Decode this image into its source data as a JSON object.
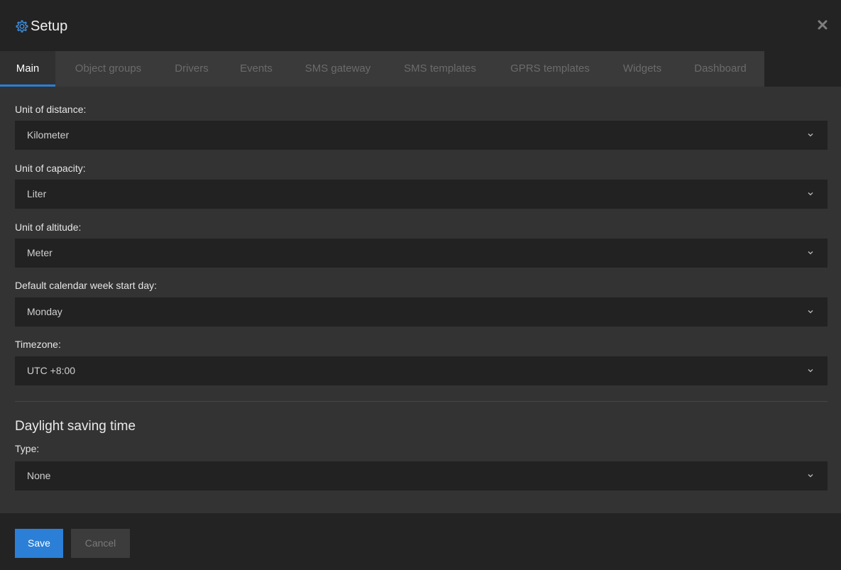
{
  "window": {
    "title": "Setup",
    "close_icon": "close-icon",
    "title_icon": "gear-icon"
  },
  "tabs": [
    {
      "label": "Main",
      "active": true
    },
    {
      "label": "Object groups",
      "active": false
    },
    {
      "label": "Drivers",
      "active": false
    },
    {
      "label": "Events",
      "active": false
    },
    {
      "label": "SMS gateway",
      "active": false
    },
    {
      "label": "SMS templates",
      "active": false
    },
    {
      "label": "GPRS templates",
      "active": false
    },
    {
      "label": "Widgets",
      "active": false
    },
    {
      "label": "Dashboard",
      "active": false
    }
  ],
  "fields": {
    "distance": {
      "label": "Unit of distance:",
      "value": "Kilometer"
    },
    "capacity": {
      "label": "Unit of capacity:",
      "value": "Liter"
    },
    "altitude": {
      "label": "Unit of altitude:",
      "value": "Meter"
    },
    "week_start": {
      "label": "Default calendar week start day:",
      "value": "Monday"
    },
    "timezone": {
      "label": "Timezone:",
      "value": "UTC +8:00"
    }
  },
  "dst": {
    "section_title": "Daylight saving time",
    "type": {
      "label": "Type:",
      "value": "None"
    }
  },
  "footer": {
    "save_label": "Save",
    "cancel_label": "Cancel"
  },
  "colors": {
    "accent": "#2b7fd6",
    "background": "#333333",
    "select_background": "#222222"
  }
}
